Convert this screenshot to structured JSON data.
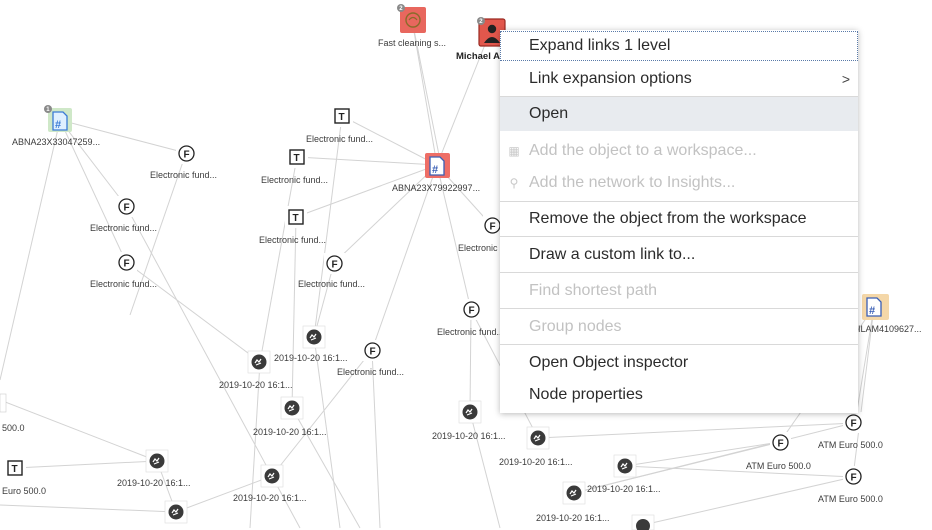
{
  "graph": {
    "nodes": {
      "fast_cleaning": {
        "label": "Fast cleaning s...",
        "badge": "2"
      },
      "michael": {
        "label": "Michael A..."
      },
      "michael_badge": "2",
      "abna1": {
        "label": "ABNA23X33047259...",
        "badge": "1"
      },
      "abna2": {
        "label": "ABNA23X79922997..."
      },
      "ilam": {
        "label": "ILAM4109627..."
      },
      "eft1": {
        "label": "Electronic fund..."
      },
      "eft2": {
        "label": "Electronic fund..."
      },
      "eft3": {
        "label": "Electronic fund..."
      },
      "eft4": {
        "label": "Electronic fund..."
      },
      "eft5": {
        "label": "Electronic fund..."
      },
      "eft6": {
        "label": "Electronic fund..."
      },
      "eft7": {
        "label": "Electronic fund..."
      },
      "eft8": {
        "label": "Electronic fund..."
      },
      "eft9": {
        "label": "Electronic fund..."
      },
      "eft10": {
        "label": "Electronic fund..."
      },
      "t1_glyph": "T",
      "t2_glyph": "T",
      "t3_glyph": "T",
      "t4_glyph": "T",
      "f_glyph": "F",
      "date1": {
        "label": "2019-10-20 16:1..."
      },
      "date2": {
        "label": "2019-10-20 16:1..."
      },
      "date3": {
        "label": "2019-10-20 16:1..."
      },
      "date4": {
        "label": "2019-10-20 16:1..."
      },
      "date5": {
        "label": "2019-10-20 16:1..."
      },
      "date6": {
        "label": "2019-10-20 16:1..."
      },
      "date7": {
        "label": "2019-10-20 16:1..."
      },
      "date8": {
        "label": "2019-10-20 16:1..."
      },
      "date9": {
        "label": "2019-10-20 16:1..."
      },
      "date10": {
        "label": "2019-10-20 16:1..."
      },
      "atm1": {
        "label": "ATM Euro 500.0"
      },
      "atm2": {
        "label": "ATM Euro 500.0"
      },
      "atm3": {
        "label": "ATM Euro 500.0"
      },
      "euro_left": {
        "label": "Euro 500.0"
      },
      "left_500": {
        "label": "500.0"
      }
    },
    "colors": {
      "account_blue": "#3a7bd5",
      "account_red": "#e2574c",
      "account_orange": "#f1a34c",
      "edge": "#d0d0d0"
    }
  },
  "context_menu": {
    "items": [
      {
        "label": "Expand links 1 level",
        "state": "focused"
      },
      {
        "label": "Link expansion options",
        "submenu": true
      },
      {
        "label": "Open",
        "state": "hovered"
      },
      {
        "label": "Add the object to a workspace...",
        "state": "disabled",
        "icon": "workspace-icon"
      },
      {
        "label": "Add the network to Insights...",
        "state": "disabled",
        "icon": "insights-icon"
      },
      {
        "label": "Remove the object from the workspace"
      },
      {
        "label": "Draw a custom link to..."
      },
      {
        "label": "Find shortest path",
        "state": "disabled"
      },
      {
        "label": "Group nodes",
        "state": "disabled"
      },
      {
        "label": "Open Object inspector"
      },
      {
        "label": "Node properties"
      }
    ],
    "submenu_arrow": ">"
  }
}
